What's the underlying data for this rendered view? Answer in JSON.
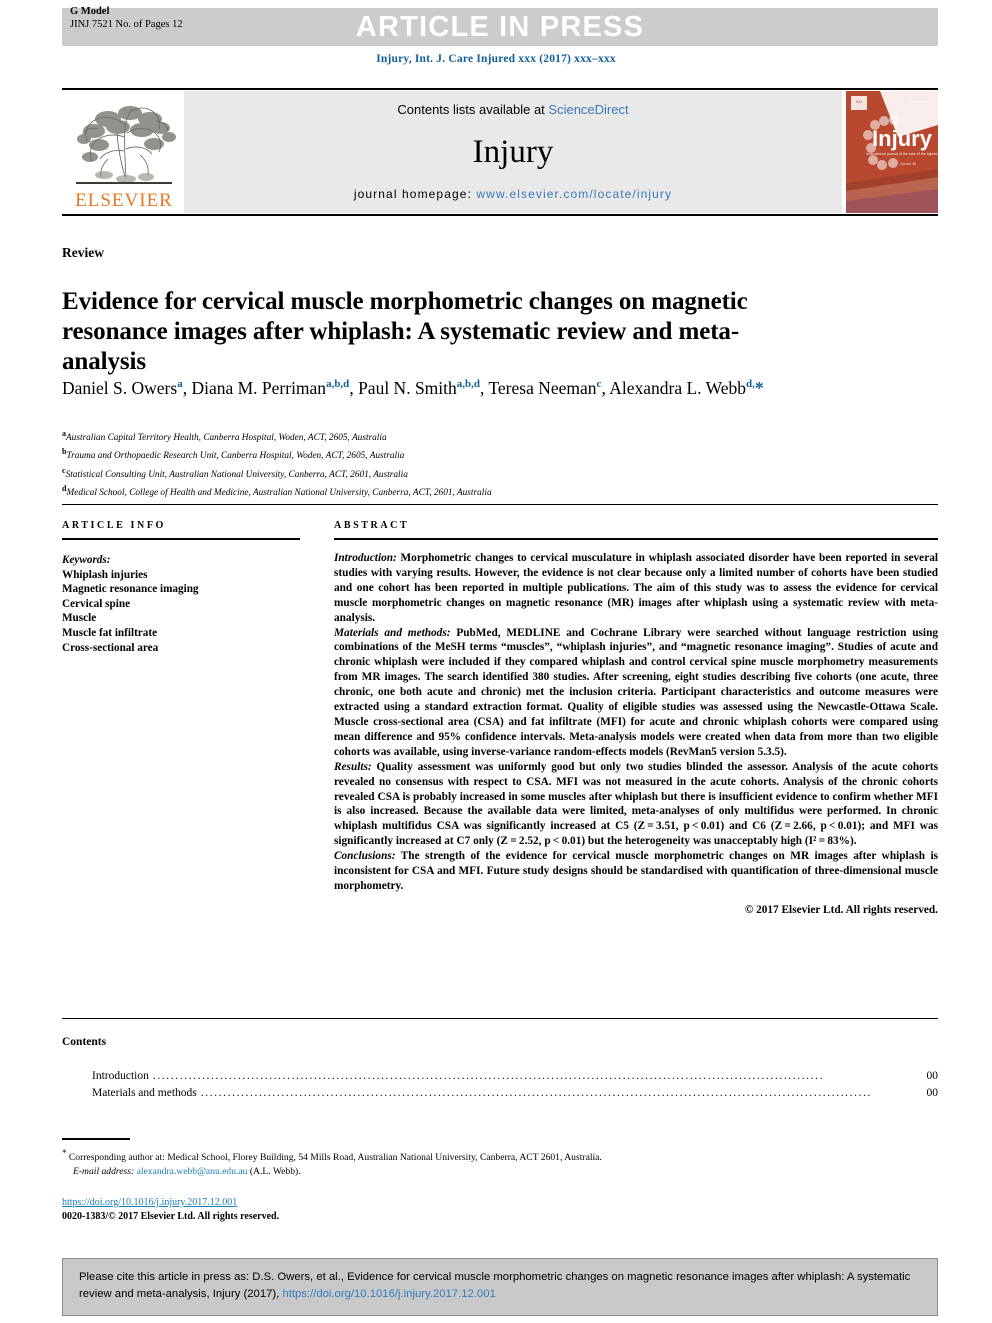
{
  "header": {
    "gmodel_line1": "G Model",
    "gmodel_line2": "JINJ 7521 No. of Pages 12",
    "banner": "ARTICLE IN PRESS",
    "citation_line": "Injury, Int. J. Care Injured xxx (2017) xxx–xxx"
  },
  "masthead": {
    "contents_prefix": "Contents lists available at ",
    "sciencedirect": "ScienceDirect",
    "journal_name": "Injury",
    "homepage_label": "journal homepage: ",
    "homepage_url": "www.elsevier.com/locate/injury",
    "publisher": "ELSEVIER",
    "cover_title": "Injury",
    "cover_subtitle": "international journal of the care of the injured"
  },
  "article": {
    "type": "Review",
    "title": "Evidence for cervical muscle morphometric changes on magnetic resonance images after whiplash: A systematic review and meta-analysis",
    "authors_html": "Daniel S. Owers<sup>a</sup>, Diana M. Perriman<sup>a,b,d</sup>, Paul N. Smith<sup>a,b,d</sup>, Teresa Neeman<sup>c</sup>, Alexandra L. Webb<sup>d,</sup><span class=\"star\">*</span>",
    "affiliations": [
      {
        "mark": "a",
        "text": "Australian Capital Territory Health, Canberra Hospital, Woden, ACT, 2605, Australia"
      },
      {
        "mark": "b",
        "text": "Trauma and Orthopaedic Research Unit, Canberra Hospital, Woden, ACT, 2605, Australia"
      },
      {
        "mark": "c",
        "text": "Statistical Consulting Unit, Australian National University, Canberra, ACT, 2601, Australia"
      },
      {
        "mark": "d",
        "text": "Medical School, College of Health and Medicine, Australian National University, Canberra, ACT, 2601, Australia"
      }
    ]
  },
  "article_info": {
    "heading": "ARTICLE INFO",
    "keywords_label": "Keywords:",
    "keywords": [
      "Whiplash injuries",
      "Magnetic resonance imaging",
      "Cervical spine",
      "Muscle",
      "Muscle fat infiltrate",
      "Cross-sectional area"
    ]
  },
  "abstract": {
    "heading": "ABSTRACT",
    "sections": [
      {
        "label": "Introduction:",
        "text": " Morphometric changes to cervical musculature in whiplash associated disorder have been reported in several studies with varying results. However, the evidence is not clear because only a limited number of cohorts have been studied and one cohort has been reported in multiple publications. The aim of this study was to assess the evidence for cervical muscle morphometric changes on magnetic resonance (MR) images after whiplash using a systematic review with meta-analysis."
      },
      {
        "label": "Materials and methods:",
        "text": " PubMed, MEDLINE and Cochrane Library were searched without language restriction using combinations of the MeSH terms “muscles”, “whiplash injuries”, and “magnetic resonance imaging”. Studies of acute and chronic whiplash were included if they compared whiplash and control cervical spine muscle morphometry measurements from MR images. The search identified 380 studies. After screening, eight studies describing five cohorts (one acute, three chronic, one both acute and chronic) met the inclusion criteria. Participant characteristics and outcome measures were extracted using a standard extraction format. Quality of eligible studies was assessed using the Newcastle-Ottawa Scale. Muscle cross-sectional area (CSA) and fat infiltrate (MFI) for acute and chronic whiplash cohorts were compared using mean difference and 95% confidence intervals. Meta-analysis models were created when data from more than two eligible cohorts was available, using inverse-variance random-effects models (RevMan5 version 5.3.5)."
      },
      {
        "label": "Results:",
        "text": " Quality assessment was uniformly good but only two studies blinded the assessor. Analysis of the acute cohorts revealed no consensus with respect to CSA. MFI was not measured in the acute cohorts. Analysis of the chronic cohorts revealed CSA is probably increased in some muscles after whiplash but there is insufficient evidence to confirm whether MFI is also increased. Because the available data were limited, meta-analyses of only multifidus were performed. In chronic whiplash multifidus CSA was significantly increased at C5 (Z = 3.51, p < 0.01) and C6 (Z = 2.66, p < 0.01); and MFI was significantly increased at C7 only (Z = 2.52, p < 0.01) but the heterogeneity was unacceptably high (I² = 83%)."
      },
      {
        "label": "Conclusions:",
        "text": " The strength of the evidence for cervical muscle morphometric changes on MR images after whiplash is inconsistent for CSA and MFI. Future study designs should be standardised with quantification of three-dimensional muscle morphometry."
      }
    ],
    "copyright": "© 2017 Elsevier Ltd. All rights reserved."
  },
  "contents": {
    "heading": "Contents",
    "items": [
      {
        "label": "Introduction",
        "page": "00"
      },
      {
        "label": "Materials and methods",
        "page": "00"
      }
    ],
    "dot_leader": "......................................................................................................................................................"
  },
  "footnotes": {
    "corresponding_marker": "*",
    "corresponding_text": " Corresponding author at: Medical School, Florey Building, 54 Mills Road, Australian National University, Canberra, ACT 2601, Australia.",
    "email_label": "E-mail address:",
    "email": "alexandra.webb@anu.edu.au",
    "email_suffix": " (A.L. Webb)."
  },
  "doi_block": {
    "doi_url": "https://doi.org/10.1016/j.injury.2017.12.001",
    "issn_line": "0020-1383/© 2017 Elsevier Ltd. All rights reserved."
  },
  "cite_box": {
    "prefix": "Please cite this article in press as: D.S. Owers, et al., Evidence for cervical muscle morphometric changes on magnetic resonance images after whiplash: A systematic review and meta-analysis, Injury (2017), ",
    "link": "https://doi.org/10.1016/j.injury.2017.12.001"
  },
  "colors": {
    "link_blue": "#3a79b8",
    "citation_blue": "#115f9a",
    "elsevier_orange": "#e87722",
    "banner_grey": "#cccccc",
    "panel_grey": "#e9e9e9",
    "cite_box_grey": "#c9c9c9"
  }
}
